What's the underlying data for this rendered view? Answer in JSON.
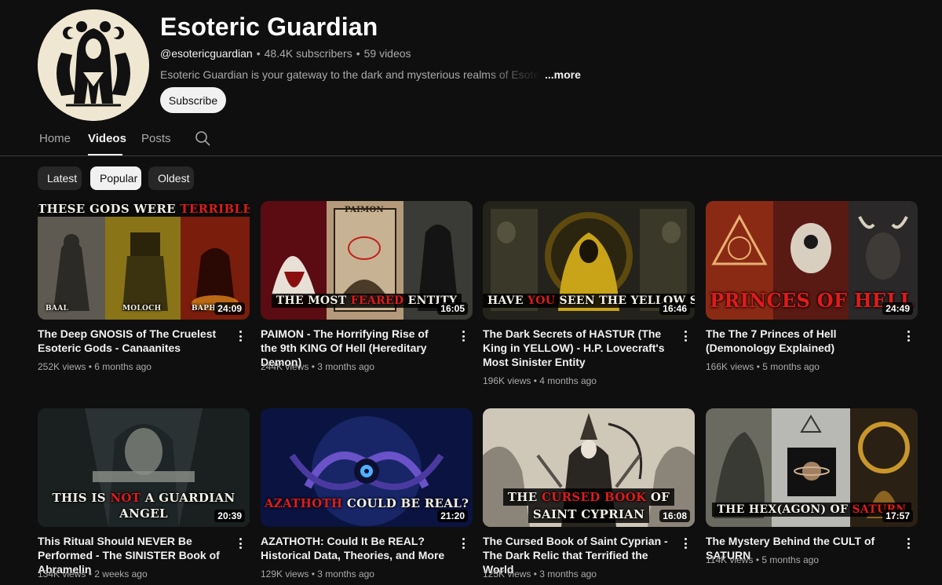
{
  "channel": {
    "name": "Esoteric Guardian",
    "handle": "@esotericguardian",
    "subscribers": "48.4K subscribers",
    "videos_count": "59 videos",
    "separator": "•",
    "description": "Esoteric Guardian is your gateway to the dark and mysterious realms of Esotericism and the occult.",
    "more_label": "...more",
    "subscribe_label": "Subscribe"
  },
  "tabs": [
    {
      "label": "Home",
      "active": false
    },
    {
      "label": "Videos",
      "active": true
    },
    {
      "label": "Posts",
      "active": false
    }
  ],
  "filters": [
    {
      "label": "Latest",
      "active": false
    },
    {
      "label": "Popular",
      "active": true
    },
    {
      "label": "Oldest",
      "active": false
    }
  ],
  "videos": [
    {
      "title": "The Deep GNOSIS of The Cruelest Esoteric Gods - Canaanites",
      "views": "252K views",
      "age": "6 months ago",
      "duration": "24:09",
      "thumb_caption": [
        "THESE GODS WERE ",
        "TERRIBLE"
      ],
      "thumb_labels": [
        "BAAL",
        "MOLOCH",
        "BAPHO"
      ]
    },
    {
      "title": "PAIMON - The Horrifying Rise of the 9th KING Of Hell (Hereditary Demon)",
      "views": "244K views",
      "age": "3 months ago",
      "duration": "16:05",
      "thumb_caption": [
        "THE MOST ",
        "FEARED",
        " ENTITY"
      ],
      "thumb_top_label": "PAIMON"
    },
    {
      "title": "The Dark Secrets of HASTUR (The King in YELLOW) - H.P. Lovecraft's Most Sinister Entity",
      "views": "196K views",
      "age": "4 months ago",
      "duration": "16:46",
      "thumb_caption": [
        "HAVE ",
        "YOU",
        " SEEN THE YELLOW SIGN?"
      ]
    },
    {
      "title": "The The 7 Princes of Hell (Demonology Explained)",
      "views": "166K views",
      "age": "5 months ago",
      "duration": "24:49",
      "thumb_caption": [
        "PRINCES OF HELL"
      ]
    },
    {
      "title": "This Ritual Should NEVER Be Performed - The SINISTER Book of Abramelin",
      "views": "134K views",
      "age": "2 weeks ago",
      "duration": "20:39",
      "thumb_caption": [
        "THIS IS ",
        "NOT",
        " A GUARDIAN",
        "ANGEL"
      ]
    },
    {
      "title": "AZATHOTH: Could It Be REAL? Historical Data, Theories, and More",
      "views": "129K views",
      "age": "3 months ago",
      "duration": "21:20",
      "thumb_caption": [
        "AZATHOTH",
        " COULD BE REAL?"
      ]
    },
    {
      "title": "The Cursed Book of Saint Cyprian - The Dark Relic that Terrified the World",
      "views": "125K views",
      "age": "3 months ago",
      "duration": "16:08",
      "thumb_caption": [
        "THE ",
        "CURSED BOOK",
        " OF",
        "SAINT CYPRIAN"
      ]
    },
    {
      "title": "The Mystery Behind the CULT of SATURN",
      "views": "114K views",
      "age": "5 months ago",
      "duration": "17:57",
      "thumb_caption": [
        "THE HEX(AGON) OF ",
        "SATURN"
      ]
    }
  ],
  "colors": {
    "background": "#0f0f0f",
    "chip_bg": "#272727",
    "chip_active_bg": "#f1f1f1",
    "text_primary": "#f1f1f1",
    "text_secondary": "#aaaaaa",
    "thumb_accent_red": "#e01b1b"
  },
  "icons": {
    "search": "search-icon",
    "more": "more-vert-icon"
  }
}
